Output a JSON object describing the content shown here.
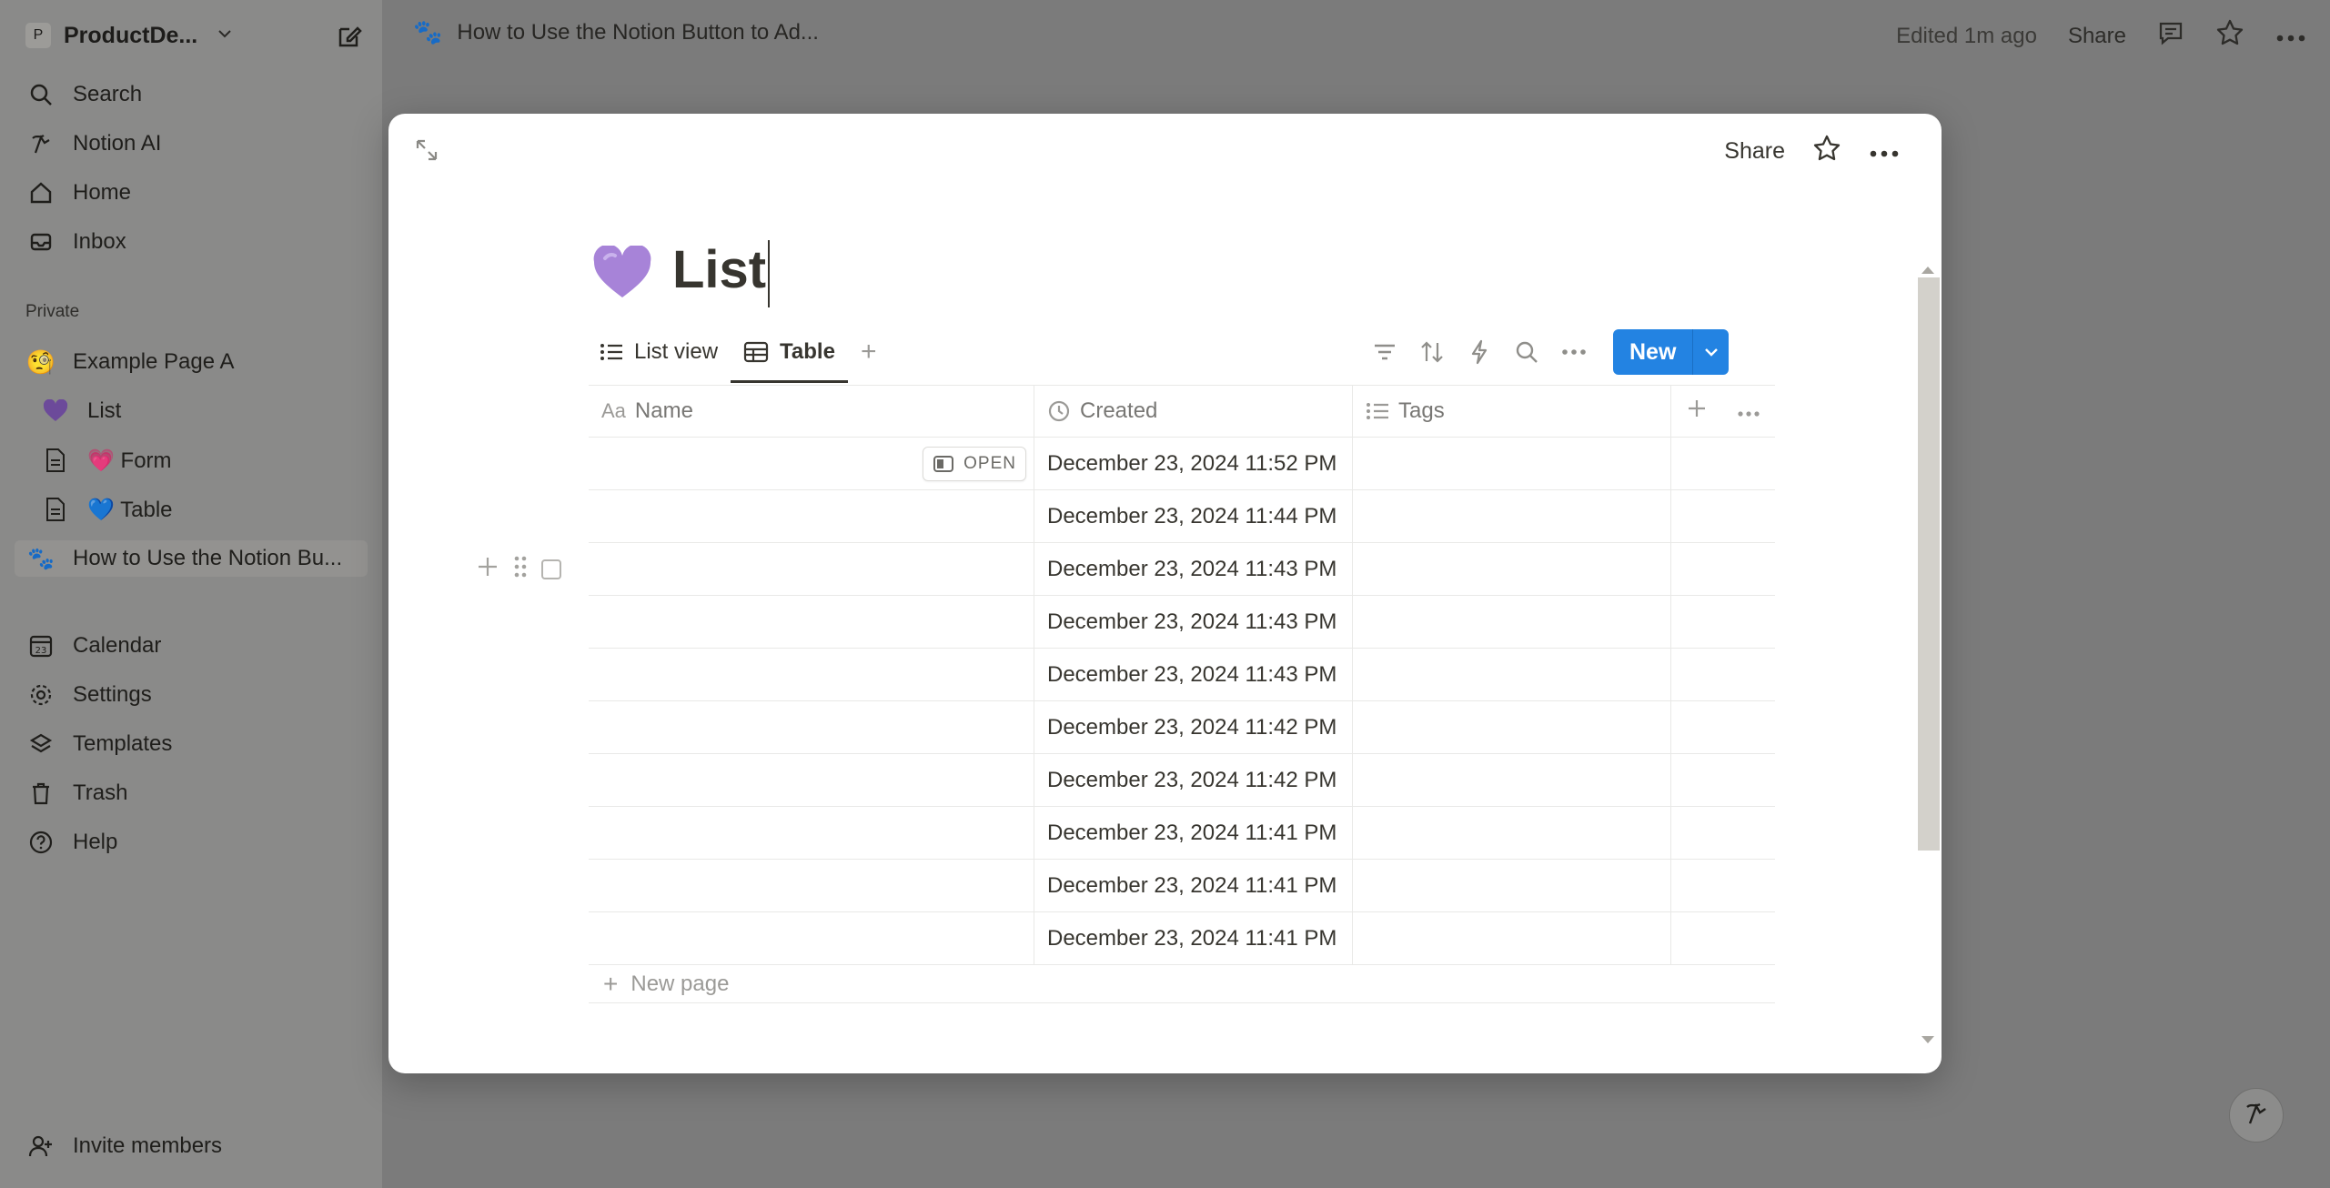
{
  "workspace": {
    "badge": "P",
    "name": "ProductDe..."
  },
  "sidebar": {
    "top_items": [
      {
        "label": "Search",
        "icon": "search-icon"
      },
      {
        "label": "Notion AI",
        "icon": "notion-ai-icon"
      },
      {
        "label": "Home",
        "icon": "home-icon"
      },
      {
        "label": "Inbox",
        "icon": "inbox-icon"
      }
    ],
    "section_label": "Private",
    "pages": [
      {
        "label": "Example Page A",
        "emoji": "🧐"
      },
      {
        "label": "List",
        "emoji": "💜"
      },
      {
        "label": "💗 Form",
        "icon": "page-icon"
      },
      {
        "label": "💙 Table",
        "icon": "page-icon"
      },
      {
        "label": "How to Use the Notion Bu...",
        "emoji": "🐾"
      }
    ],
    "bottom_items": [
      {
        "label": "Calendar",
        "icon": "calendar-icon",
        "badge": "23"
      },
      {
        "label": "Settings",
        "icon": "gear-icon"
      },
      {
        "label": "Templates",
        "icon": "templates-icon"
      },
      {
        "label": "Trash",
        "icon": "trash-icon"
      },
      {
        "label": "Help",
        "icon": "help-icon"
      }
    ],
    "invite": "Invite members"
  },
  "topbar": {
    "breadcrumb_emoji": "🐾",
    "breadcrumb": "How to Use the Notion Button to Ad...",
    "edited": "Edited 1m ago",
    "share": "Share"
  },
  "modal": {
    "share": "Share",
    "title_emoji": "💜",
    "title": "List",
    "tabs": [
      {
        "label": "List view",
        "icon": "list-icon"
      },
      {
        "label": "Table",
        "icon": "table-icon",
        "active": true
      }
    ],
    "new_button": "New",
    "table": {
      "columns": [
        {
          "label": "Name",
          "icon": "text-property-icon",
          "icon_text": "Aa"
        },
        {
          "label": "Created",
          "icon": "clock-icon"
        },
        {
          "label": "Tags",
          "icon": "multiselect-icon"
        }
      ],
      "open_label": "OPEN",
      "rows": [
        {
          "name": "",
          "created": "December 23, 2024 11:52 PM",
          "tags": ""
        },
        {
          "name": "",
          "created": "December 23, 2024 11:44 PM",
          "tags": ""
        },
        {
          "name": "",
          "created": "December 23, 2024 11:43 PM",
          "tags": ""
        },
        {
          "name": "",
          "created": "December 23, 2024 11:43 PM",
          "tags": ""
        },
        {
          "name": "",
          "created": "December 23, 2024 11:43 PM",
          "tags": ""
        },
        {
          "name": "",
          "created": "December 23, 2024 11:42 PM",
          "tags": ""
        },
        {
          "name": "",
          "created": "December 23, 2024 11:42 PM",
          "tags": ""
        },
        {
          "name": "",
          "created": "December 23, 2024 11:41 PM",
          "tags": ""
        },
        {
          "name": "",
          "created": "December 23, 2024 11:41 PM",
          "tags": ""
        },
        {
          "name": "",
          "created": "December 23, 2024 11:41 PM",
          "tags": ""
        }
      ],
      "new_page": "New page"
    }
  },
  "colors": {
    "accent": "#2383e2",
    "overlay": "#7b7b7b",
    "text": "#37352f",
    "muted": "#787774"
  }
}
